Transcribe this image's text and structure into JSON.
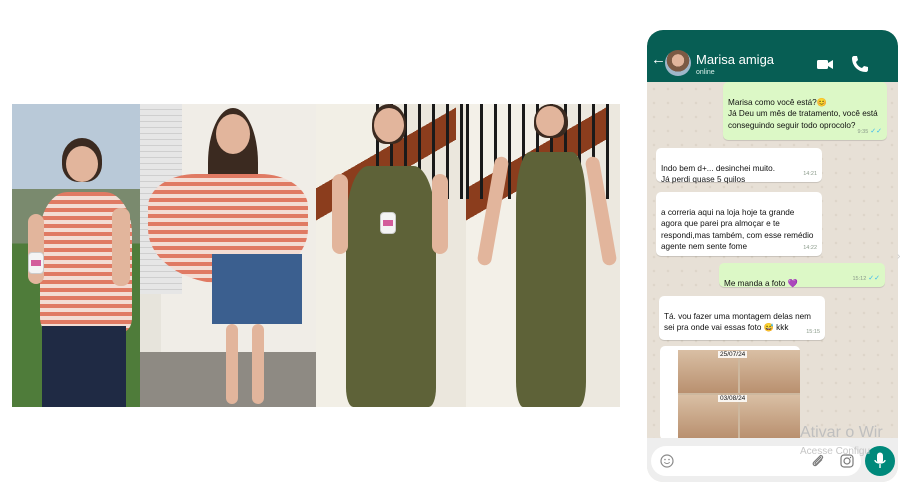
{
  "chat": {
    "contact_name": "Marisa amiga",
    "contact_status": "online",
    "messages": [
      {
        "direction": "out",
        "text": "Marisa como você está?😊\nJá Deu um mês de tratamento, você está conseguindo seguir todo oprocolo?",
        "time": "9:35",
        "ticks": "✓✓"
      },
      {
        "direction": "in",
        "text": "Indo bem d+... desinchei muito.\nJá perdi quase 5 quilos",
        "time": "14:21"
      },
      {
        "direction": "in",
        "text": "a correria aqui na loja hoje ta grande agora que parei pra almoçar e te respondi,mas também, com esse remédio agente nem sente fome",
        "time": "14:22"
      },
      {
        "direction": "out",
        "text": "Me manda a foto 💜",
        "time": "15:12",
        "ticks": "✓✓"
      },
      {
        "direction": "in",
        "text": "Tá. vou fazer uma montagem delas nem sei pra onde vai essas foto 😅 kkk",
        "time": "15:15"
      }
    ],
    "image_dates": [
      "25/07/24",
      "03/08/24"
    ]
  },
  "icons": {
    "back": "arrow-left-icon",
    "video": "video-camera-icon",
    "call": "phone-icon",
    "emoji": "emoji-icon",
    "attach": "paperclip-icon",
    "camera": "camera-icon",
    "mic": "microphone-icon"
  },
  "colors": {
    "header": "#075e54",
    "outgoing_bubble": "#dcf8c6",
    "incoming_bubble": "#ffffff",
    "mic_button": "#00897b"
  },
  "watermark": {
    "line1": "Ativar o Wir",
    "line2": "Acesse Configu"
  }
}
